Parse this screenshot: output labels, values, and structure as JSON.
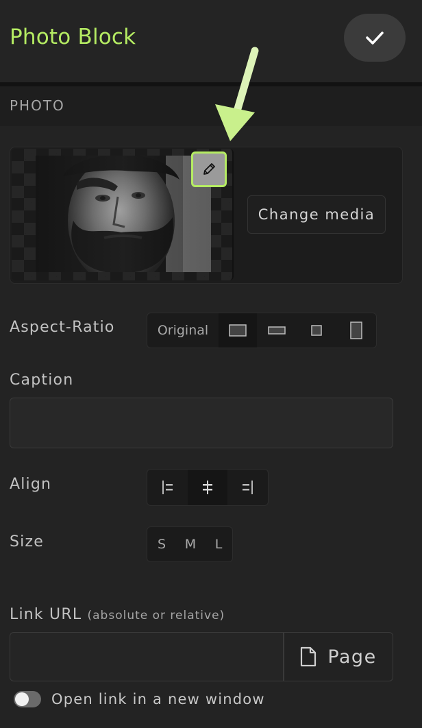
{
  "header": {
    "title": "Photo Block",
    "confirm_icon": "checkmark-icon",
    "accent": "#b5ec63"
  },
  "section": {
    "title": "PHOTO"
  },
  "photo": {
    "edit_icon": "pencil-icon",
    "change_media_label": "Change media"
  },
  "aspect_ratio": {
    "label": "Aspect-Ratio",
    "options": [
      {
        "label": "Original",
        "icon": ""
      },
      {
        "label": "",
        "icon": "landscape-ratio-icon",
        "active": true
      },
      {
        "label": "",
        "icon": "wide-ratio-icon"
      },
      {
        "label": "",
        "icon": "square-ratio-icon"
      },
      {
        "label": "",
        "icon": "portrait-ratio-icon"
      }
    ]
  },
  "caption": {
    "label": "Caption",
    "value": "",
    "placeholder": ""
  },
  "align": {
    "label": "Align",
    "options": [
      {
        "icon": "align-left-icon"
      },
      {
        "icon": "align-center-icon",
        "active": true
      },
      {
        "icon": "align-right-icon"
      }
    ]
  },
  "size": {
    "label": "Size",
    "options": [
      "S",
      "M",
      "L"
    ]
  },
  "link": {
    "label": "Link URL",
    "hint": "(absolute or relative)",
    "value": "",
    "page_button_label": "Page",
    "page_icon": "document-icon"
  },
  "new_window": {
    "label": "Open link in a new window",
    "enabled": false
  }
}
